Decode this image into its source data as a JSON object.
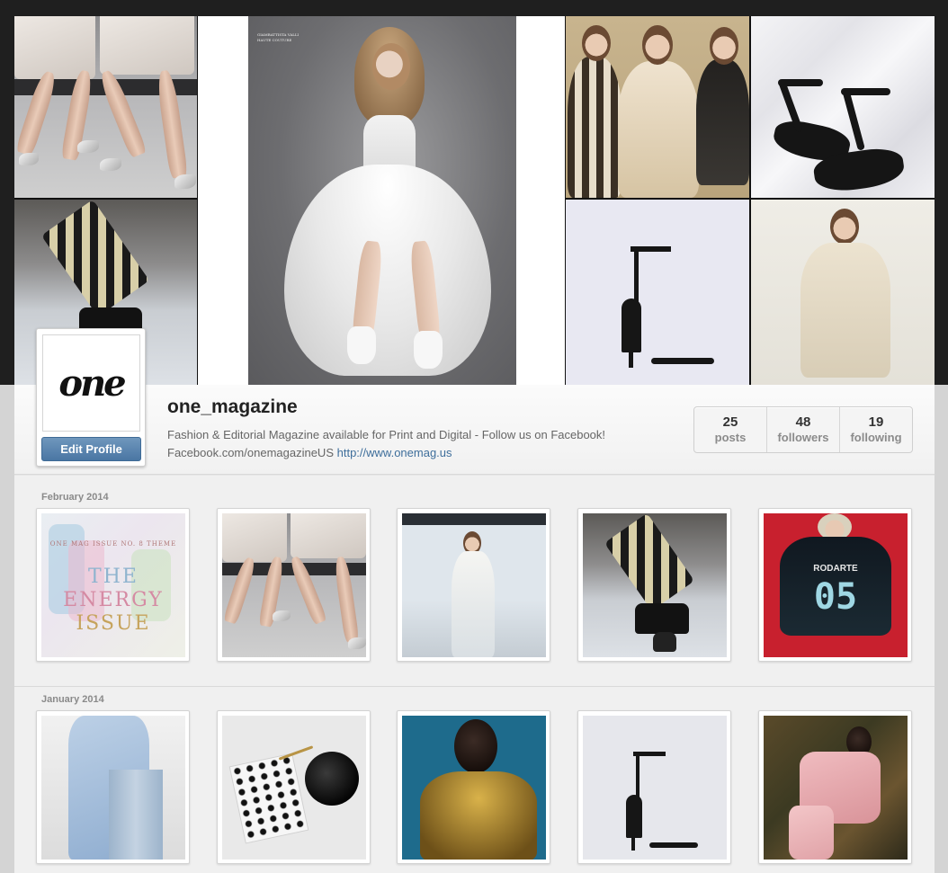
{
  "profile": {
    "username": "one_magazine",
    "avatar_text": "one",
    "edit_button": "Edit Profile",
    "bio_line1": "Fashion & Editorial Magazine available for Print and Digital - Follow us on Facebook!",
    "bio_line2_prefix": "Facebook.com/onemagazineUS",
    "bio_link": "http://www.onemag.us"
  },
  "stats": [
    {
      "value": "25",
      "label": "posts"
    },
    {
      "value": "48",
      "label": "followers"
    },
    {
      "value": "19",
      "label": "following"
    }
  ],
  "feed": {
    "months": [
      {
        "label": "February 2014"
      },
      {
        "label": "January 2014"
      }
    ]
  },
  "energy_cover": {
    "small_text": "ONE MAG ISSUE NO. 8 THEME",
    "line1": "THE",
    "line2": "ENERGY",
    "line3": "ISSUE"
  },
  "jersey": {
    "brand": "RODARTE",
    "number": "05"
  },
  "gown_caption": "GIAMBATTISTA VALLI HAUTE COUTURE",
  "colors": {
    "accent": "#4a76a3",
    "link": "#3e6e9b",
    "page_bg": "#f0f0f0"
  }
}
